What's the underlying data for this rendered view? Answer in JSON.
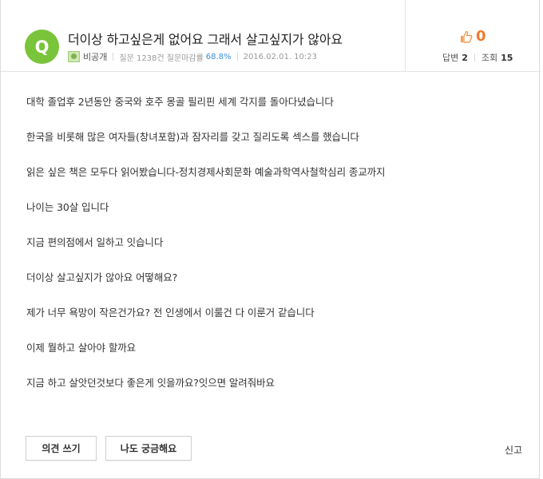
{
  "question": {
    "badge": "Q",
    "title": "더이상 하고싶은게 없어요 그래서 살고싶지가 않아요",
    "author": "비공개",
    "stats_text": "질문 1238건 질문마감률",
    "close_rate": "68.8%",
    "date": "2016.02.01. 10:23"
  },
  "stats": {
    "likes": "0",
    "answers_label": "답변",
    "answers_count": "2",
    "views_label": "조회",
    "views_count": "15"
  },
  "body": {
    "paragraphs": [
      "대학 졸업후 2년동안 중국와 호주 몽골 필리핀 세계 각지를 돌아다녔습니다",
      "한국을 비롯해 많은 여자들(창녀포함)과 잠자리를 갖고 질리도록 섹스를 했습니다",
      "읽은 싶은 책은 모두다 읽어봤습니다-정치경제사회문화 예술과학역사철학심리 종교까지",
      "나이는 30살 입니다",
      "지금 편의점에서 일하고 잇습니다",
      "더이상 살고싶지가 않아요 어떻해요?",
      "제가 너무 욕망이 작은건가요? 전 인생에서 이룰건 다 이룬거 같습니다",
      "이제 뭘하고 살아야 할까요",
      "지금 하고 살앗던것보다 좋은게 잇을까요?잇으면 알려줘바요"
    ]
  },
  "actions": {
    "opinion_button": "의견 쓰기",
    "curious_button": "나도 궁금해요",
    "report_link": "신고"
  },
  "colors": {
    "badge": "#79c43a",
    "like_count": "#f07a2b",
    "close_rate": "#3d8ed6"
  }
}
